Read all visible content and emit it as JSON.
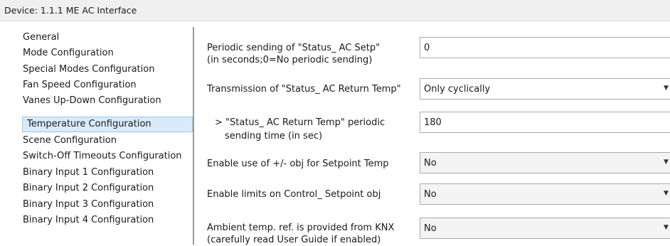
{
  "window": {
    "title": "Device: 1.1.1  ME AC Interface"
  },
  "sidebar": {
    "items": [
      {
        "label": "General"
      },
      {
        "label": "Mode Configuration"
      },
      {
        "label": "Special Modes Configuration"
      },
      {
        "label": "Fan Speed Configuration"
      },
      {
        "label": "Vanes Up-Down Configuration"
      },
      {
        "label": "Temperature Configuration",
        "selected": true
      },
      {
        "label": "Scene Configuration"
      },
      {
        "label": "Switch-Off Timeouts Configuration"
      },
      {
        "label": "Binary Input 1 Configuration"
      },
      {
        "label": "Binary Input 2 Configuration"
      },
      {
        "label": "Binary Input 3 Configuration"
      },
      {
        "label": "Binary Input 4 Configuration"
      }
    ]
  },
  "params": {
    "status_setp": {
      "label_line1": "Periodic sending of \"Status_ AC Setp\"",
      "label_line2": "(in seconds;0=No periodic sending)",
      "value": "0"
    },
    "transmission_return_temp": {
      "label": "Transmission of \"Status_ AC Return Temp\"",
      "value": "Only cyclically"
    },
    "return_temp_period": {
      "label_line1": "> \"Status_ AC Return Temp\" periodic",
      "label_line2": "sending time (in sec)",
      "value": "180"
    },
    "enable_plus_minus": {
      "label": "Enable use of +/- obj for Setpoint Temp",
      "value": "No"
    },
    "enable_limits": {
      "label": "Enable limits on Control_ Setpoint obj",
      "value": "No"
    },
    "ambient_knx": {
      "label_line1": "Ambient temp. ref. is provided from KNX",
      "label_line2": "(carefully read User Guide if enabled)",
      "value": "No"
    }
  },
  "colors": {
    "selection_bg": "#d9ebf9",
    "selection_border": "#9cc6ea",
    "titlebar_bg": "#f0f0f0"
  },
  "icons": {
    "spinner_up": "▲",
    "spinner_down": "▼",
    "dropdown": "▼"
  }
}
